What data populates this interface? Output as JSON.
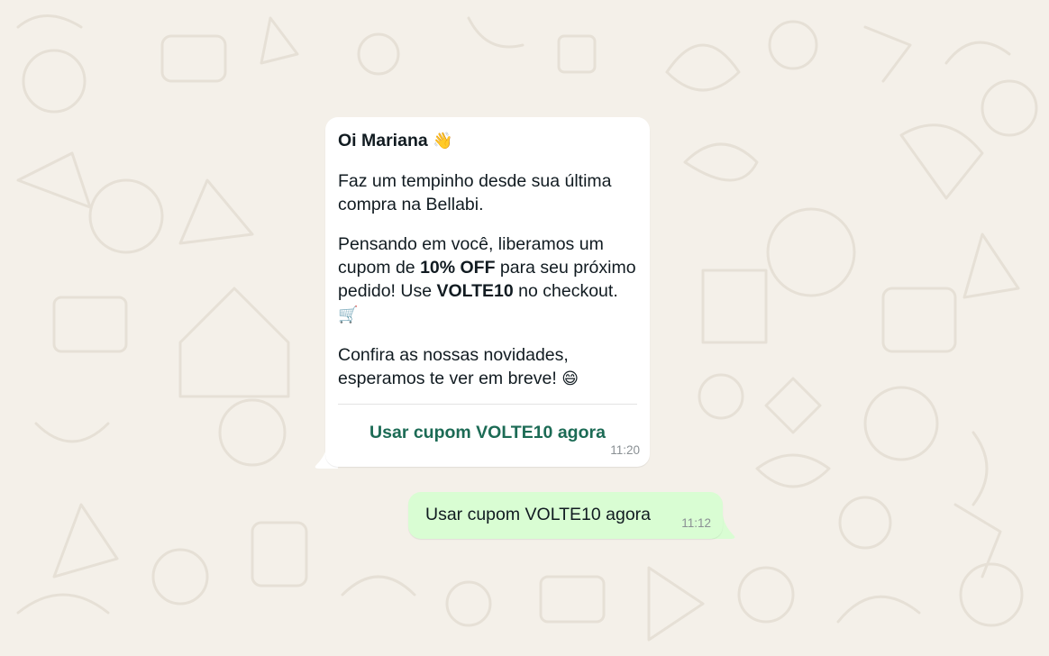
{
  "incoming_message": {
    "greeting": "Oi Mariana",
    "greeting_emoji": "👋",
    "paragraph1": "Faz um tempinho desde sua última compra na Bellabi.",
    "paragraph2_part1": "Pensando em você, liberamos um cupom de ",
    "paragraph2_bold1": "10% OFF",
    "paragraph2_part2": " para seu próximo pedido! Use ",
    "paragraph2_bold2": "VOLTE10",
    "paragraph2_part3": " no checkout.",
    "paragraph2_emoji": "🛒",
    "paragraph3": "Confira as nossas novidades, esperamos te ver em breve!",
    "paragraph3_emoji": "😄",
    "button_label": "Usar cupom VOLTE10 agora",
    "time": "11:20"
  },
  "outgoing_message": {
    "text": "Usar cupom VOLTE10 agora",
    "time": "11:12"
  },
  "colors": {
    "wallpaper": "#f4f0e9",
    "incoming_bubble": "#ffffff",
    "outgoing_bubble": "#d9fdd3",
    "button_text": "#1c6b55"
  }
}
